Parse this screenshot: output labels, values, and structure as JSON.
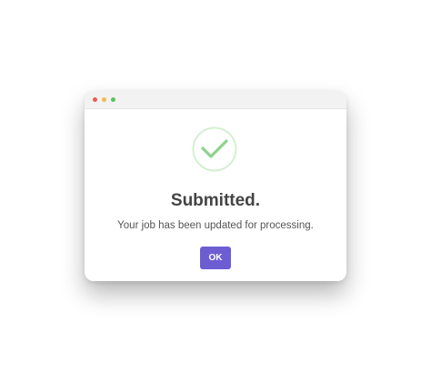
{
  "dialog": {
    "title": "Submitted.",
    "message": "Your job has been updated for processing.",
    "ok_label": "OK",
    "icon": "check-circle-icon"
  },
  "window_controls": [
    "close",
    "minimize",
    "maximize"
  ],
  "colors": {
    "accent": "#6c5dd3",
    "success": "#8fd28a",
    "success_ring": "#d4efd2",
    "dot_red": "#ec5b4f",
    "dot_yellow": "#f2b94a",
    "dot_green": "#5bc35a"
  }
}
